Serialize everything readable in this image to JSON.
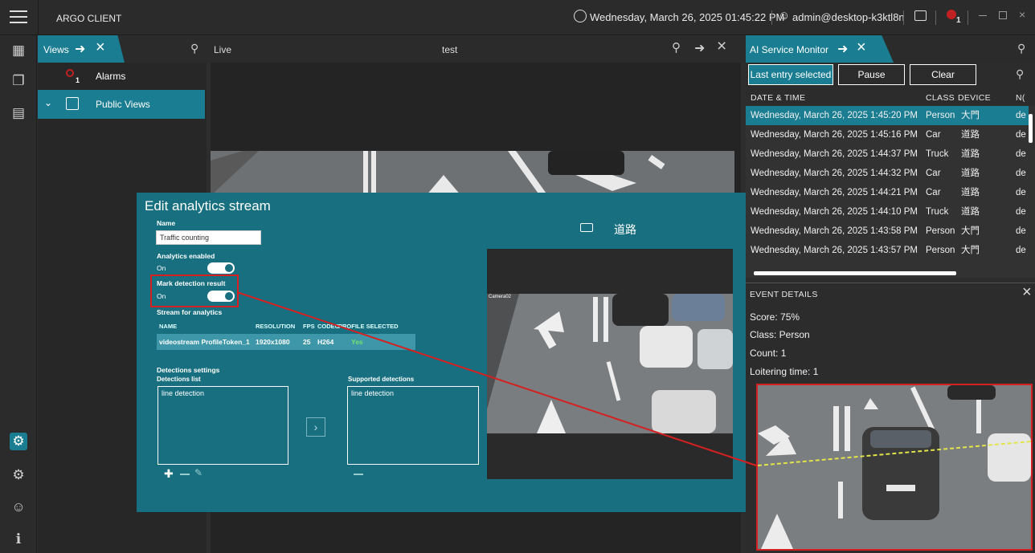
{
  "app": {
    "title": "ARGO CLIENT",
    "datetime": "Wednesday, March 26, 2025 01:45:22 PM",
    "user": "admin@desktop-k3ktl8n",
    "alarm_count": "1"
  },
  "views": {
    "tab_label": "Views",
    "alarms_label": "Alarms",
    "alarm_badge": "1",
    "public_views_label": "Public Views"
  },
  "live": {
    "tab_label": "Live",
    "view_name": "test"
  },
  "dialog": {
    "title": "Edit analytics stream",
    "name_label": "Name",
    "name_value": "Traffic counting",
    "analytics_label": "Analytics enabled",
    "analytics_state": "On",
    "mark_label": "Mark detection result",
    "mark_state": "On",
    "stream_label": "Stream for analytics",
    "stream_columns": [
      "NAME",
      "RESOLUTION",
      "FPS",
      "CODEC",
      "PROFILE SELECTED"
    ],
    "stream_row": {
      "name": "videostream ProfileToken_1",
      "resolution": "1920x1080",
      "fps": "25",
      "codec": "H264",
      "selected": "Yes"
    },
    "detections_settings_label": "Detections settings",
    "detections_list_label": "Detections list",
    "supported_label": "Supported detections",
    "detections_list": [
      "line detection"
    ],
    "supported_list": [
      "line detection"
    ],
    "camera_label": "道路",
    "preview_caption": "Camera02"
  },
  "ai": {
    "tab_label": "AI Service Monitor",
    "btn_last": "Last entry selected",
    "btn_pause": "Pause",
    "btn_clear": "Clear",
    "columns": {
      "datetime": "DATE & TIME",
      "class": "CLASS",
      "device": "DEVICE",
      "n": "N("
    },
    "rows": [
      {
        "datetime": "Wednesday, March 26, 2025 1:45:20 PM",
        "class": "Person",
        "device": "大門",
        "n": "de"
      },
      {
        "datetime": "Wednesday, March 26, 2025 1:45:16 PM",
        "class": "Car",
        "device": "道路",
        "n": "de"
      },
      {
        "datetime": "Wednesday, March 26, 2025 1:44:37 PM",
        "class": "Truck",
        "device": "道路",
        "n": "de"
      },
      {
        "datetime": "Wednesday, March 26, 2025 1:44:32 PM",
        "class": "Car",
        "device": "道路",
        "n": "de"
      },
      {
        "datetime": "Wednesday, March 26, 2025 1:44:21 PM",
        "class": "Car",
        "device": "道路",
        "n": "de"
      },
      {
        "datetime": "Wednesday, March 26, 2025 1:44:10 PM",
        "class": "Truck",
        "device": "道路",
        "n": "de"
      },
      {
        "datetime": "Wednesday, March 26, 2025 1:43:58 PM",
        "class": "Person",
        "device": "大門",
        "n": "de"
      },
      {
        "datetime": "Wednesday, March 26, 2025 1:43:57 PM",
        "class": "Person",
        "device": "大門",
        "n": "de"
      }
    ],
    "event_details_label": "EVENT DETAILS",
    "score": "Score: 75%",
    "class": "Class: Person",
    "count": "Count: 1",
    "loitering": "Loitering time: 1"
  },
  "colors": {
    "accent": "#1a7d91",
    "dialog": "#176f80",
    "highlight": "#d42020"
  }
}
